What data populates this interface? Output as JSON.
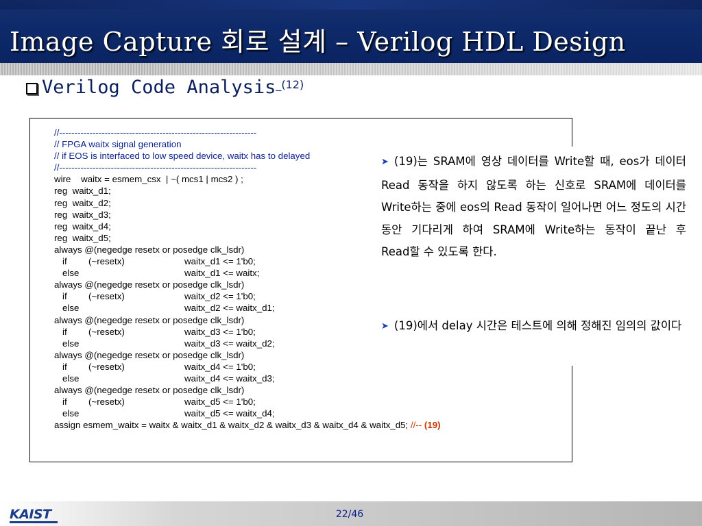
{
  "title": "Image Capture 회로 설계 – Verilog HDL Design",
  "section": {
    "title": "Verilog Code Analysis",
    "subtitle": "_(12)"
  },
  "code": {
    "lines": [
      {
        "c1": "//-----------------------------------------------------------------",
        "blue": true
      },
      {
        "c1": "// FPGA waitx signal generation",
        "blue": true
      },
      {
        "c1": "// if EOS is interfaced to low speed device, waitx has to delayed",
        "blue": true
      },
      {
        "c1": "//-----------------------------------------------------------------",
        "blue": true
      },
      {
        "c1": "wire    waitx = esmem_csx  | ~( mcs1 | mcs2 ) ;"
      },
      {
        "c1": "reg  waitx_d1;"
      },
      {
        "c1": "reg  waitx_d2;"
      },
      {
        "c1": "reg  waitx_d3;"
      },
      {
        "c1": "reg  waitx_d4;"
      },
      {
        "c1": "reg  waitx_d5;"
      },
      {
        "c1": "always @(negedge resetx or posedge clk_lsdr)"
      },
      {
        "k": "if",
        "cond": "(~resetx)",
        "stmt": "waitx_d1 <= 1'b0;"
      },
      {
        "k": "else",
        "cond": "",
        "stmt": "waitx_d1 <= waitx;"
      },
      {
        "c1": "always @(negedge resetx or posedge clk_lsdr)"
      },
      {
        "k": "if",
        "cond": "(~resetx)",
        "stmt": "waitx_d2 <= 1'b0;"
      },
      {
        "k": "else",
        "cond": "",
        "stmt": "waitx_d2 <= waitx_d1;"
      },
      {
        "c1": "always @(negedge resetx or posedge clk_lsdr)"
      },
      {
        "k": "if",
        "cond": "(~resetx)",
        "stmt": "waitx_d3 <= 1'b0;"
      },
      {
        "k": "else",
        "cond": "",
        "stmt": "waitx_d3 <= waitx_d2;"
      },
      {
        "c1": "always @(negedge resetx or posedge clk_lsdr)"
      },
      {
        "k": "if",
        "cond": "(~resetx)",
        "stmt": "waitx_d4 <= 1'b0;"
      },
      {
        "k": "else",
        "cond": "",
        "stmt": "waitx_d4 <= waitx_d3;"
      },
      {
        "c1": "always @(negedge resetx or posedge clk_lsdr)"
      },
      {
        "k": "if",
        "cond": "(~resetx)",
        "stmt": "waitx_d5 <= 1'b0;"
      },
      {
        "k": "else",
        "cond": "",
        "stmt": "waitx_d5 <= waitx_d4;"
      },
      {
        "c1": "assign esmem_waitx = waitx & waitx_d1 & waitx_d2 & waitx_d3 & waitx_d4 & waitx_d5; ",
        "comment": "//-- ",
        "tag": "(19)"
      }
    ]
  },
  "notes": [
    "(19)는 SRAM에 영상 데이터를 Write할 때, eos가 데이터 Read 동작을 하지 않도록 하는 신호로 SRAM에 데이터를 Write하는 중에 eos의 Read 동작이 일어나면 어느 정도의 시간 동안 기다리게 하여 SRAM에 Write하는 동작이 끝난 후 Read할 수 있도록 한다.",
    "(19)에서 delay 시간은 테스트에 의해 정해진 임의의 값이다"
  ],
  "footer": {
    "logo": "KAIST",
    "page": "22/46"
  },
  "colors": {
    "title_bar": "#0a2463",
    "accent_text": "#0b1f5c",
    "comment_red": "#cc3300",
    "note_arrow": "#1a3fb0"
  },
  "icons": {
    "section_bullet": "checkbox-icon",
    "note_bullet": "arrow-right-icon"
  }
}
